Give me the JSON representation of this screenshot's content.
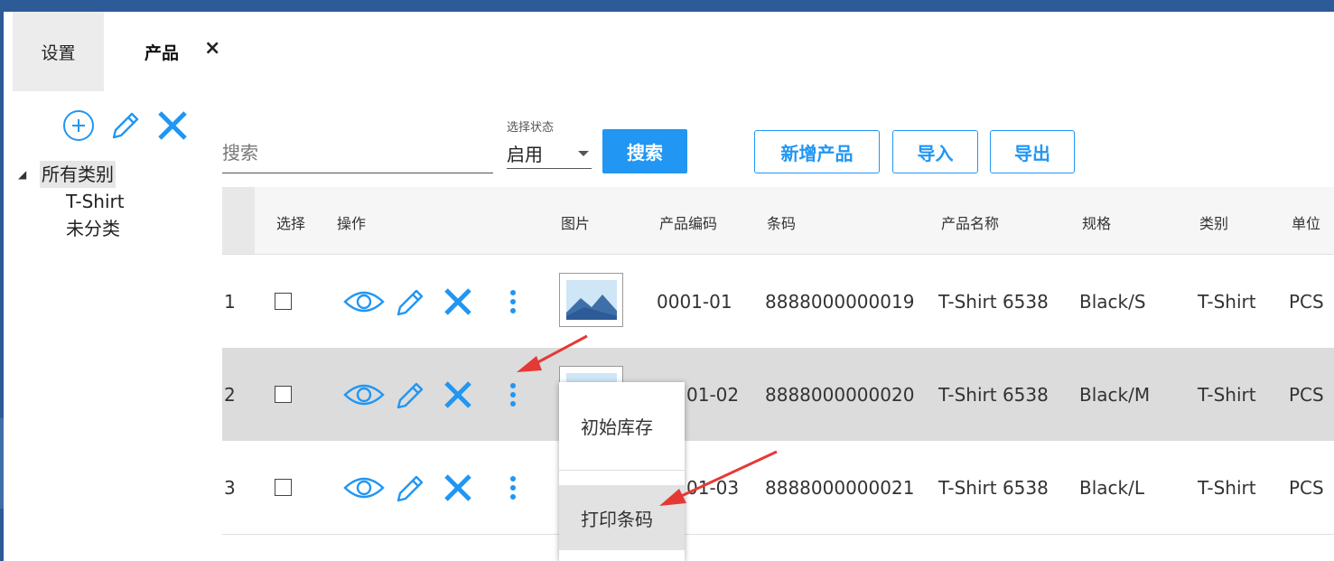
{
  "tabs": {
    "settings_label": "设置",
    "product_label": "产品",
    "close_glyph": "×"
  },
  "category": {
    "root_label": "所有类别",
    "children": [
      "T-Shirt",
      "未分类"
    ],
    "icons": [
      "add-circle-icon",
      "pencil-icon",
      "close-icon"
    ]
  },
  "toolbar": {
    "search_placeholder": "搜索",
    "status_label": "选择状态",
    "status_value": "启用",
    "search_button": "搜索",
    "add_button": "新增产品",
    "import_button": "导入",
    "export_button": "导出"
  },
  "table": {
    "headers": {
      "select": "选择",
      "action": "操作",
      "image": "图片",
      "code": "产品编码",
      "barcode": "条码",
      "name": "产品名称",
      "spec": "规格",
      "category": "类别",
      "unit": "单位"
    },
    "rows": [
      {
        "num": "1",
        "code": "0001-01",
        "barcode": "8888000000019",
        "name": "T-Shirt 6538",
        "spec": "Black/S",
        "category": "T-Shirt",
        "unit": "PCS"
      },
      {
        "num": "2",
        "code": "01-02",
        "barcode": "8888000000020",
        "name": "T-Shirt 6538",
        "spec": "Black/M",
        "category": "T-Shirt",
        "unit": "PCS"
      },
      {
        "num": "3",
        "code": "01-03",
        "barcode": "8888000000021",
        "name": "T-Shirt 6538",
        "spec": "Black/L",
        "category": "T-Shirt",
        "unit": "PCS"
      }
    ]
  },
  "context_menu": {
    "items": [
      "初始库存",
      "打印条码"
    ]
  },
  "colors": {
    "accent": "#2196f3",
    "titlebar": "#2c5b97",
    "annotation_arrow": "#e53935"
  }
}
